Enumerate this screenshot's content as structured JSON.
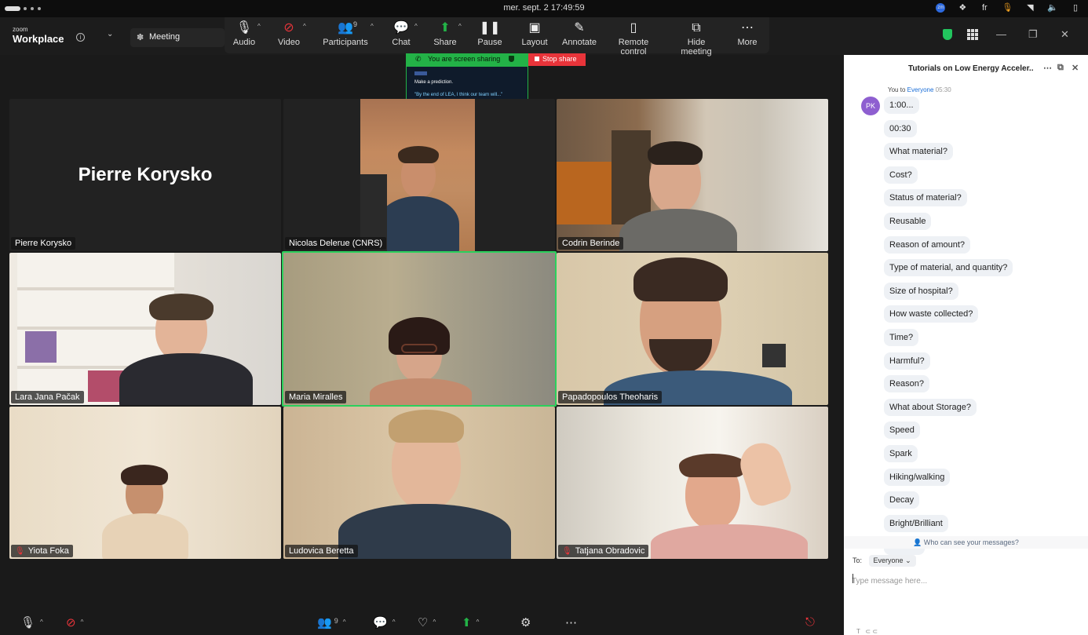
{
  "os": {
    "clock": "mer. sept. 2  17:49:59",
    "lang": "fr"
  },
  "zoom": {
    "brand_small": "zoom",
    "brand_big": "Workplace",
    "meeting_label": "Meeting",
    "controls": [
      {
        "label": "Audio",
        "icon": "microphone-icon"
      },
      {
        "label": "Video",
        "icon": "video-off-icon"
      },
      {
        "label": "Participants",
        "icon": "participants-icon",
        "count": "9"
      },
      {
        "label": "Chat",
        "icon": "chat-icon"
      },
      {
        "label": "Share",
        "icon": "share-icon"
      },
      {
        "label": "Pause",
        "icon": "pause-icon"
      },
      {
        "label": "Layout",
        "icon": "layout-icon"
      },
      {
        "label": "Annotate",
        "icon": "pencil-icon"
      },
      {
        "label": "Remote control",
        "icon": "mouse-icon"
      },
      {
        "label": "Hide meeting",
        "icon": "hide-icon"
      },
      {
        "label": "More",
        "icon": "more-icon"
      }
    ]
  },
  "sharing": {
    "status": "You are screen sharing",
    "stop": "Stop share",
    "preview_heading": "Make a prediction.",
    "preview_quote": "\"By the end of LEA, I think our team will...\""
  },
  "participants": [
    {
      "name": "Pierre Korysko",
      "big_name": "Pierre Korysko",
      "video": false
    },
    {
      "name": "Nicolas Delerue (CNRS)",
      "video": true
    },
    {
      "name": "Codrin Berinde",
      "video": true
    },
    {
      "name": "Lara Jana Pačak",
      "video": true
    },
    {
      "name": "Maria Miralles",
      "video": true,
      "active_speaker": true
    },
    {
      "name": "Papadopoulos Theoharis",
      "video": true
    },
    {
      "name": "Yiota Foka",
      "video": true,
      "muted": true
    },
    {
      "name": "Ludovica Beretta",
      "video": true
    },
    {
      "name": "Tatjana Obradovic",
      "video": true,
      "muted": true
    }
  ],
  "bottom": {
    "participants_count": "9"
  },
  "chat": {
    "title": "Tutorials on Low Energy Acceler...",
    "avatar": "PK",
    "meta_from": "You to",
    "meta_to": "Everyone",
    "meta_time": "05:30",
    "messages": [
      "1:00...",
      "00:30",
      "What material?",
      "Cost?",
      "Status of material?",
      "Reusable",
      "Reason of amount?",
      "Type of material, and quantity?",
      "Size of hospital?",
      "How waste collected?",
      "Time?",
      "Harmful?",
      "Reason?",
      "What about Storage?",
      "Speed",
      "Spark",
      "Hiking/walking",
      "Decay",
      "Bright/Brilliant",
      "Medical"
    ],
    "who_can_see": "Who can see your messages?",
    "to_label": "To:",
    "to_value": "Everyone",
    "input_placeholder": "Type message here..."
  },
  "colors": {
    "share_green": "#23b247",
    "stop_red": "#e8343a",
    "active_border": "#2bd05c",
    "avatar_purple": "#8e5fd0",
    "link_blue": "#1a6ed8"
  }
}
